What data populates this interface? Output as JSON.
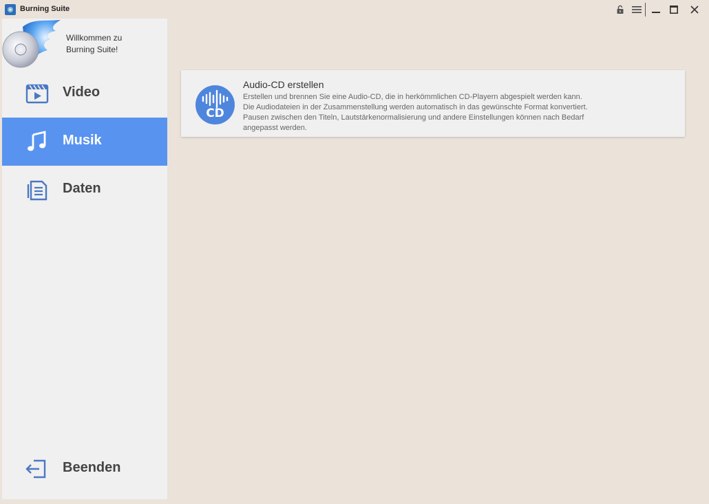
{
  "window": {
    "title": "Burning Suite"
  },
  "sidebar": {
    "welcome_line1": "Willkommen zu",
    "welcome_line2": "Burning Suite!",
    "items": [
      {
        "label": "Video",
        "icon": "video-icon"
      },
      {
        "label": "Musik",
        "icon": "music-note-icon"
      },
      {
        "label": "Daten",
        "icon": "document-icon"
      }
    ],
    "exit_label": "Beenden"
  },
  "main": {
    "cards": [
      {
        "title": "Audio-CD erstellen",
        "icon": "audio-cd-icon",
        "icon_text": "CD",
        "description": [
          "Erstellen und brennen Sie eine Audio-CD, die in herkömmlichen CD-Playern abgespielt werden kann.",
          "Die Audiodateien in der Zusammenstellung werden automatisch in das gewünschte Format konvertiert.",
          "Pausen zwischen den Titeln, Lautstärkenormalisierung und andere Einstellungen können nach Bedarf",
          "angepasst werden."
        ]
      }
    ]
  },
  "colors": {
    "accent": "#5893f0",
    "icon_blue": "#4f86dd",
    "background": "#ebe2da",
    "panel": "#f0f0f0"
  }
}
